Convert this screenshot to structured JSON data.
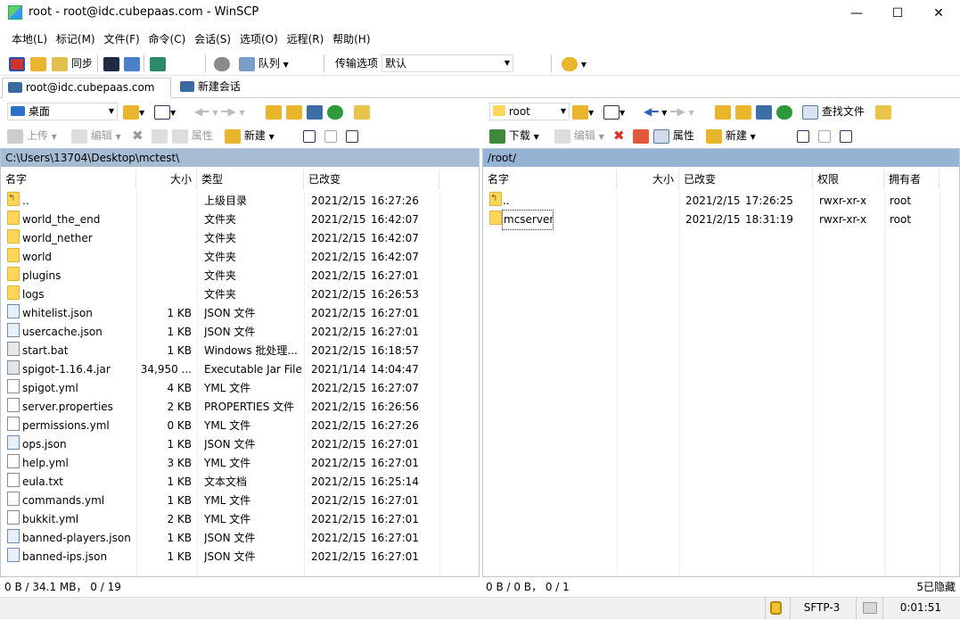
{
  "window": {
    "title": "root - root@idc.cubepaas.com - WinSCP",
    "minimize": "—",
    "maximize": "☐",
    "close": "✕"
  },
  "menu": [
    "本地(L)",
    "标记(M)",
    "文件(F)",
    "命令(C)",
    "会话(S)",
    "选项(O)",
    "远程(R)",
    "帮助(H)"
  ],
  "toolbar": {
    "sync_label": "同步",
    "queue_label": "队列",
    "transfer_options_label": "传输选项",
    "transfer_options_value": "默认"
  },
  "tabs": {
    "session": "root@idc.cubepaas.com",
    "new_session": "新建会话"
  },
  "local": {
    "location": "桌面",
    "upload": "上传",
    "edit": "编辑",
    "properties": "属性",
    "new": "新建",
    "path": "C:\\Users\\13704\\Desktop\\mctest\\",
    "columns": [
      "名字",
      "大小",
      "类型",
      "已改变"
    ],
    "files": [
      {
        "name": "..",
        "size": "",
        "type": "上级目录",
        "date": "2021/2/15",
        "time": "16:27:26",
        "icon": "parent"
      },
      {
        "name": "world_the_end",
        "size": "",
        "type": "文件夹",
        "date": "2021/2/15",
        "time": "16:42:07",
        "icon": "folder"
      },
      {
        "name": "world_nether",
        "size": "",
        "type": "文件夹",
        "date": "2021/2/15",
        "time": "16:42:07",
        "icon": "folder"
      },
      {
        "name": "world",
        "size": "",
        "type": "文件夹",
        "date": "2021/2/15",
        "time": "16:42:07",
        "icon": "folder"
      },
      {
        "name": "plugins",
        "size": "",
        "type": "文件夹",
        "date": "2021/2/15",
        "time": "16:27:01",
        "icon": "folder"
      },
      {
        "name": "logs",
        "size": "",
        "type": "文件夹",
        "date": "2021/2/15",
        "time": "16:26:53",
        "icon": "folder"
      },
      {
        "name": "whitelist.json",
        "size": "1 KB",
        "type": "JSON 文件",
        "date": "2021/2/15",
        "time": "16:27:01",
        "icon": "json"
      },
      {
        "name": "usercache.json",
        "size": "1 KB",
        "type": "JSON 文件",
        "date": "2021/2/15",
        "time": "16:27:01",
        "icon": "json"
      },
      {
        "name": "start.bat",
        "size": "1 KB",
        "type": "Windows 批处理...",
        "date": "2021/2/15",
        "time": "16:18:57",
        "icon": "bat"
      },
      {
        "name": "spigot-1.16.4.jar",
        "size": "34,950 ...",
        "type": "Executable Jar File",
        "date": "2021/1/14",
        "time": "14:04:47",
        "icon": "jar"
      },
      {
        "name": "spigot.yml",
        "size": "4 KB",
        "type": "YML 文件",
        "date": "2021/2/15",
        "time": "16:27:07",
        "icon": "file"
      },
      {
        "name": "server.properties",
        "size": "2 KB",
        "type": "PROPERTIES 文件",
        "date": "2021/2/15",
        "time": "16:26:56",
        "icon": "file"
      },
      {
        "name": "permissions.yml",
        "size": "0 KB",
        "type": "YML 文件",
        "date": "2021/2/15",
        "time": "16:27:26",
        "icon": "file"
      },
      {
        "name": "ops.json",
        "size": "1 KB",
        "type": "JSON 文件",
        "date": "2021/2/15",
        "time": "16:27:01",
        "icon": "json"
      },
      {
        "name": "help.yml",
        "size": "3 KB",
        "type": "YML 文件",
        "date": "2021/2/15",
        "time": "16:27:01",
        "icon": "file"
      },
      {
        "name": "eula.txt",
        "size": "1 KB",
        "type": "文本文档",
        "date": "2021/2/15",
        "time": "16:25:14",
        "icon": "file"
      },
      {
        "name": "commands.yml",
        "size": "1 KB",
        "type": "YML 文件",
        "date": "2021/2/15",
        "time": "16:27:01",
        "icon": "file"
      },
      {
        "name": "bukkit.yml",
        "size": "2 KB",
        "type": "YML 文件",
        "date": "2021/2/15",
        "time": "16:27:01",
        "icon": "file"
      },
      {
        "name": "banned-players.json",
        "size": "1 KB",
        "type": "JSON 文件",
        "date": "2021/2/15",
        "time": "16:27:01",
        "icon": "json"
      },
      {
        "name": "banned-ips.json",
        "size": "1 KB",
        "type": "JSON 文件",
        "date": "2021/2/15",
        "time": "16:27:01",
        "icon": "json"
      }
    ],
    "status": "0 B / 34.1 MB， 0 / 19"
  },
  "remote": {
    "location": "root",
    "download": "下载",
    "edit": "编辑",
    "properties": "属性",
    "new": "新建",
    "find_files": "查找文件",
    "path": "/root/",
    "columns": [
      "名字",
      "大小",
      "已改变",
      "权限",
      "拥有者"
    ],
    "files": [
      {
        "name": "..",
        "size": "",
        "date": "2021/2/15",
        "time": "17:26:25",
        "rights": "rwxr-xr-x",
        "owner": "root",
        "icon": "parent"
      },
      {
        "name": "mcserver",
        "size": "",
        "date": "2021/2/15",
        "time": "18:31:19",
        "rights": "rwxr-xr-x",
        "owner": "root",
        "icon": "folder"
      }
    ],
    "status": "0 B / 0 B， 0 / 1",
    "hidden": "5已隐藏"
  },
  "statusbar": {
    "protocol": "SFTP-3",
    "elapsed": "0:01:51"
  }
}
